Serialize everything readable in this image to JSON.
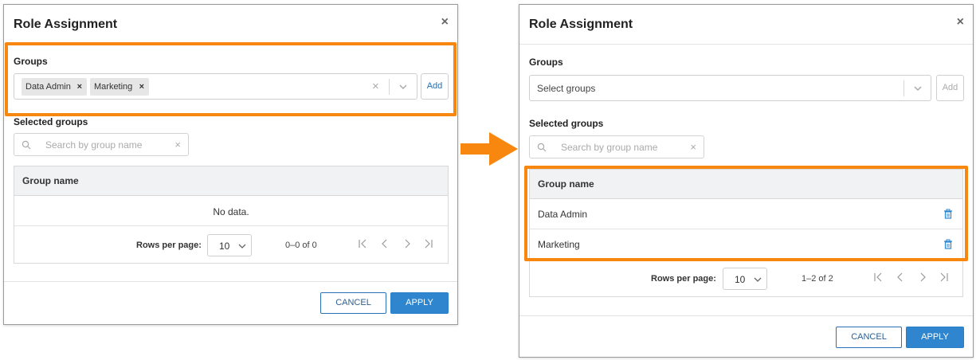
{
  "colors": {
    "highlight": "#f7870f",
    "accent": "#2f86cf",
    "add_active": "#1f6fb8"
  },
  "before": {
    "title": "Role Assignment",
    "close": "×",
    "groups_label": "Groups",
    "chips": [
      {
        "label": "Data Admin",
        "remove": "×"
      },
      {
        "label": "Marketing",
        "remove": "×"
      }
    ],
    "clear": "×",
    "add_label": "Add",
    "selected_label": "Selected groups",
    "search_placeholder": "Search by group name",
    "search_clear": "×",
    "table_header": "Group name",
    "no_data": "No data.",
    "rows_per_page_label": "Rows per page:",
    "rows_per_page_value": "10",
    "range": "0–0 of 0",
    "cancel": "CANCEL",
    "apply": "APPLY"
  },
  "after": {
    "title": "Role Assignment",
    "close": "×",
    "groups_label": "Groups",
    "select_placeholder": "Select groups",
    "add_label": "Add",
    "selected_label": "Selected groups",
    "search_placeholder": "Search by group name",
    "search_clear": "×",
    "table_header": "Group name",
    "rows": [
      {
        "name": "Data Admin"
      },
      {
        "name": "Marketing"
      }
    ],
    "rows_per_page_label": "Rows per page:",
    "rows_per_page_value": "10",
    "range": "1–2 of 2",
    "cancel": "CANCEL",
    "apply": "APPLY"
  },
  "icons": {
    "close": "close-icon",
    "chevron": "chevron-down-icon",
    "search": "search-icon",
    "trash": "trash-icon",
    "first": "first-page-icon",
    "prev": "prev-page-icon",
    "next": "next-page-icon",
    "last": "last-page-icon",
    "arrow": "arrow-right-icon"
  }
}
